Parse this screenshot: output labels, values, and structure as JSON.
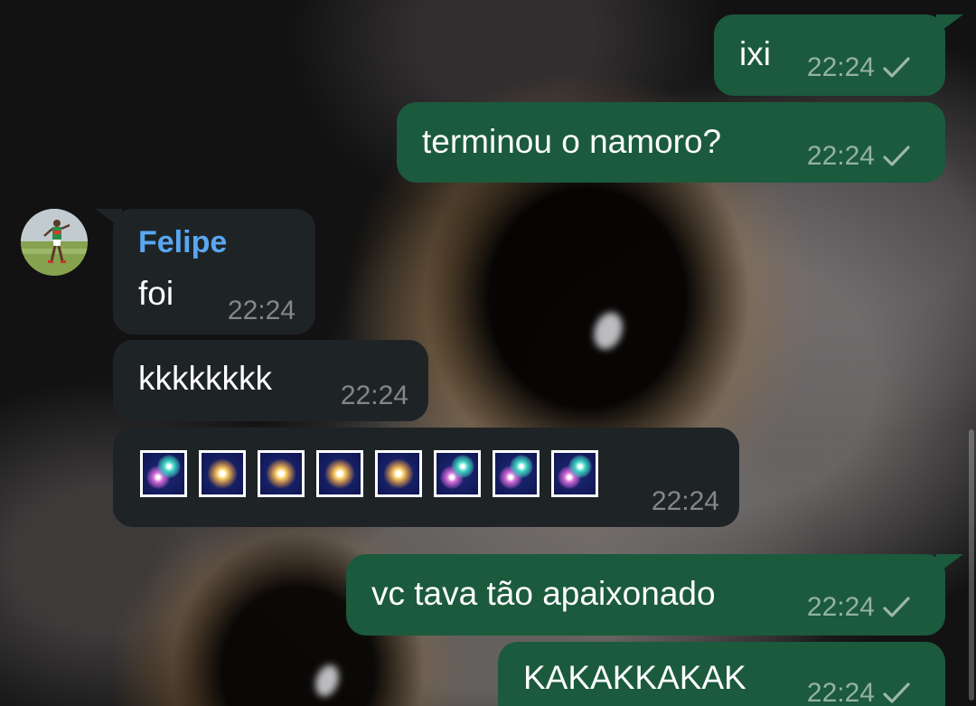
{
  "colors": {
    "outgoing_bubble": "#1b5a3d",
    "incoming_bubble": "#1e2326",
    "sender_name": "#59a7f0",
    "text": "#ffffff"
  },
  "messages": [
    {
      "direction": "outgoing",
      "text": "ixi",
      "time": "22:24",
      "status_icon": "check-icon"
    },
    {
      "direction": "outgoing",
      "text": "terminou o namoro?",
      "time": "22:24",
      "status_icon": "check-icon"
    },
    {
      "direction": "incoming",
      "sender": "Felipe",
      "avatar": "avatar-felipe",
      "text": "foi",
      "time": "22:24"
    },
    {
      "direction": "incoming",
      "text": "kkkkkkkk",
      "time": "22:24"
    },
    {
      "direction": "incoming",
      "emojis": [
        "fireworks",
        "sparkler",
        "sparkler",
        "sparkler",
        "sparkler",
        "fireworks",
        "fireworks",
        "fireworks"
      ],
      "time": "22:24"
    },
    {
      "direction": "outgoing",
      "text": "vc tava tão apaixonado",
      "time": "22:24",
      "status_icon": "check-icon"
    },
    {
      "direction": "outgoing",
      "text": "KAKAKKAKAK",
      "time": "22:24",
      "status_icon": "check-icon"
    }
  ]
}
